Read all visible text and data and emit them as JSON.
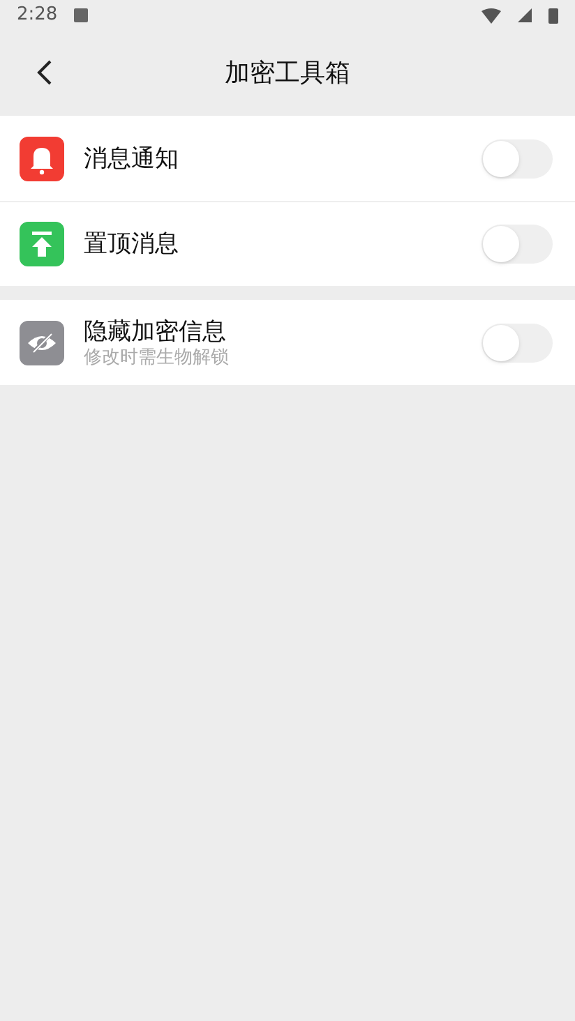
{
  "status_bar": {
    "time": "2:28"
  },
  "header": {
    "title": "加密工具箱"
  },
  "sections": [
    {
      "items": [
        {
          "kind": "bell",
          "label": "消息通知",
          "on": false
        },
        {
          "kind": "pin",
          "label": "置顶消息",
          "on": false
        }
      ]
    },
    {
      "items": [
        {
          "kind": "hidden",
          "label": "隐藏加密信息",
          "subtitle": "修改时需生物解锁",
          "on": false
        }
      ]
    }
  ]
}
